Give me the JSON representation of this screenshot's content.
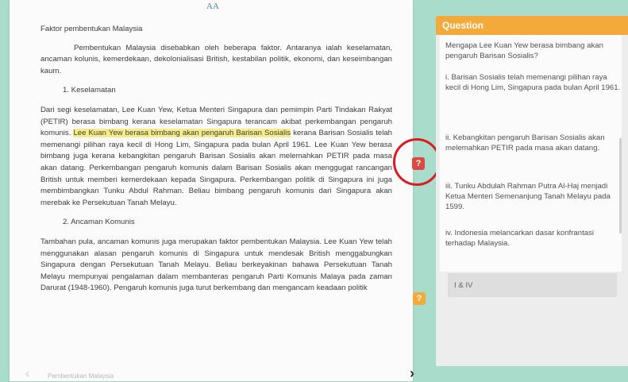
{
  "reader": {
    "font_toggle": "AA",
    "title": "Faktor pembentukan Malaysia",
    "intro": "Pembentukan Malaysia disebabkan oleh beberapa faktor. Antaranya ialah keselamatan, ancaman kolunis, kemerdekaan, dekolonialisasi British, kestabilan politik, ekonomi, dan keseimbangan kaum.",
    "heading1": "1. Keselamatan",
    "para1_a": "Dari segi keselamatan, Lee  Kuan Yew, Ketua Menteri Singapura dan pemimpin Parti Tindakan Rakyat (PETIR) berasa bimbang kerana keselamatan Singapura terancam akibat perkembangan pengaruh komunis. ",
    "para1_highlight": "Lee Kuan Yew berasa bimbang akan pengaruh Barisan Sosialis",
    "para1_b": " kerana Barisan Sosialis telah memenangi pilihan raya kecil di Hong Lim, Singapura pada bulan April 1961. Lee Kuan Yew berasa bimbang juga kerana kebangkitan pengaruh Barisan Sosialis akan melemahkan PETIR pada masa akan datang. Perkembangan pengaruh komunis dalam Barisan Sosialis akan menggugat rancangan British untuk memberi kemerdekaan kepada Singapura. Perkembangan politik di Singapura ini juga membimbangkan Tunku Abdul Rahman. Beliau bimbang pengaruh komunis dari Singapura akan merebak ke Persekutuan Tanah Melayu.",
    "heading2": "2. Ancaman Komunis",
    "para2": "Tambahan pula, ancaman komunis juga merupakan faktor pembentukan Malaysia. Lee Kuan Yew telah menggunakan alasan pengaruh komunis di Singapura untuk mendesak British menggabungkan Singapura dengan Persekutuan Tanah Melayu. Beliau berkeyakinan bahawa Persekutuan Tanah Melayu mempunyai pengalaman dalam membanteras pengaruh Parti Komunis Malaya pada zaman Darurat (1948-1960). Pengaruh komunis juga turut berkembang dan mengancam keadaan politik",
    "footer": "Pembentukan Malaysia",
    "nav_prev": "‹",
    "nav_next": "›"
  },
  "markers": {
    "red": "?",
    "orange": "?"
  },
  "question": {
    "header": "Question",
    "text": "Mengapa Lee Kuan Yew berasa bimbang akan pengaruh Barisan Sosialis?",
    "options": [
      "i. Barisan Sosialis telah memenangi pilihan raya kecil di Hong Lim, Singapura pada bulan April 1961.",
      "ii. Kebangkitan pengaruh Barisan Sosialis akan melemahkan PETIR pada masa akan datang.",
      "iii. Tunku Abdulah Rahman Putra Al-Haj menjadi Ketua Menteri Semenanjung Tanah Melayu pada 1599.",
      "iv. Indonesia melancarkan dasar konfrantasi terhadap Malaysia."
    ],
    "answer": "I & IV"
  },
  "colors": {
    "background": "#a9dccb",
    "accent_orange": "#f4a93b",
    "marker_red": "#d94a43",
    "ring_red": "#d91c22",
    "highlight": "#f6ec8a"
  }
}
